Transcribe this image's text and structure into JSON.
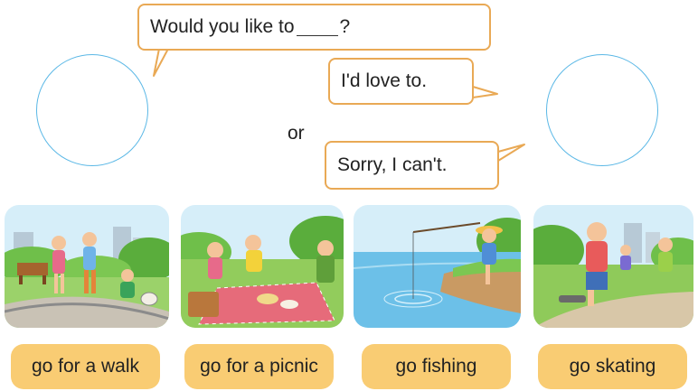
{
  "dialog": {
    "question_prefix": "Would you like to",
    "question_suffix": "?",
    "answer_yes": "I'd love to.",
    "or_text": "or",
    "answer_no": "Sorry, I can't."
  },
  "activities": [
    {
      "label": "go for a walk"
    },
    {
      "label": "go for a picnic"
    },
    {
      "label": "go fishing"
    },
    {
      "label": "go skating"
    }
  ],
  "colors": {
    "bubble_border": "#e9a955",
    "circle_border": "#5bb8e6",
    "pill_fill": "#f9cc73"
  }
}
